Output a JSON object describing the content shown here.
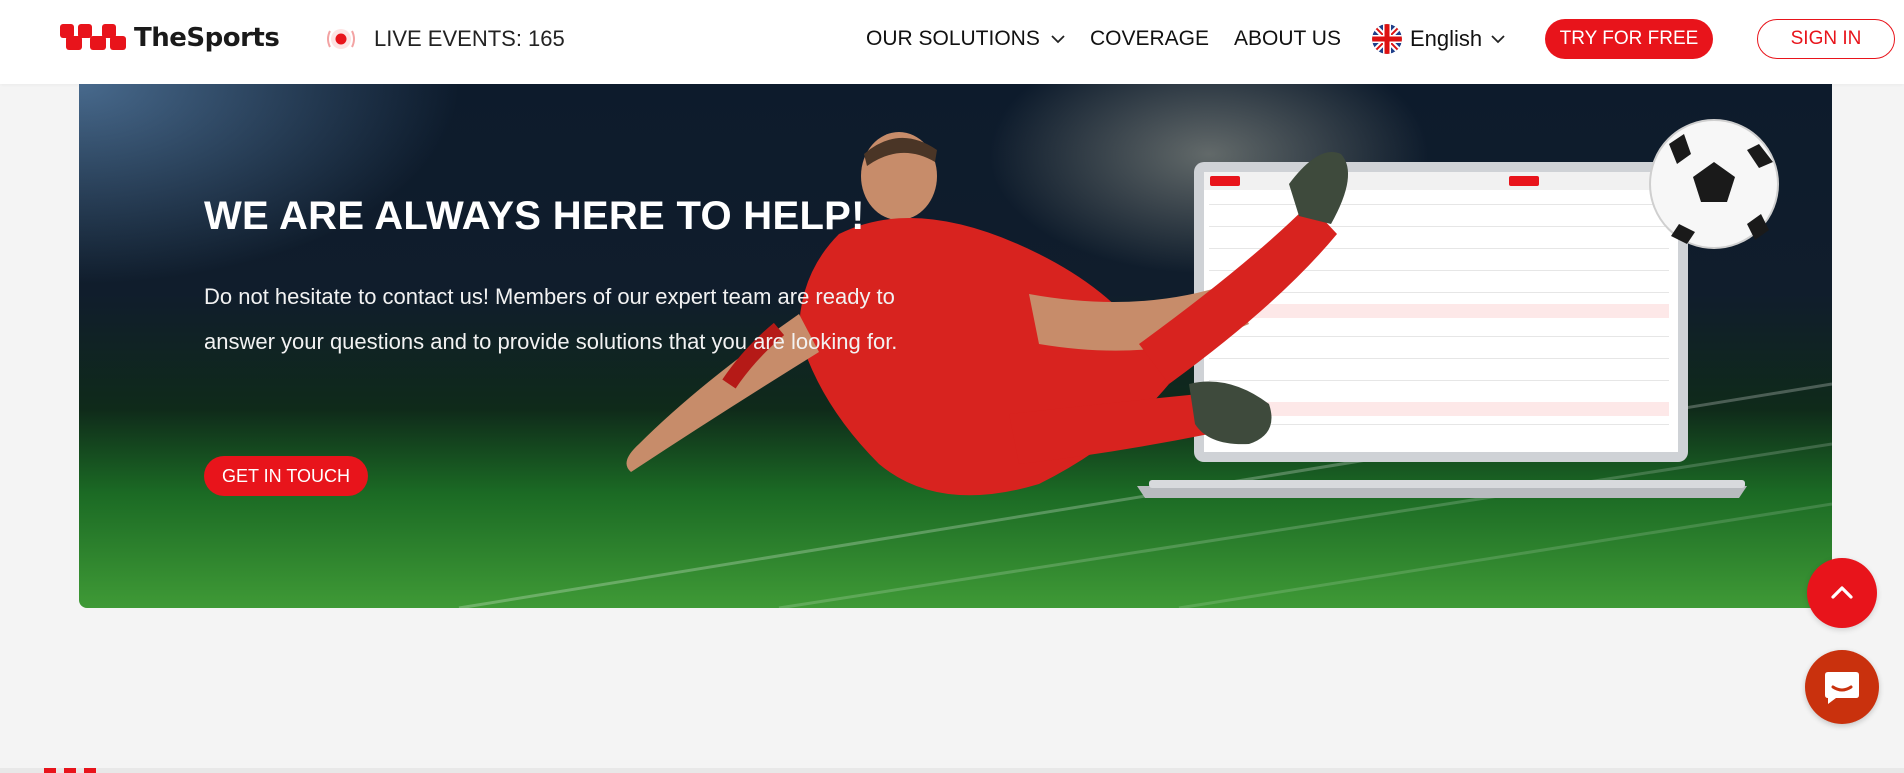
{
  "header": {
    "brand": "TheSports",
    "live_label": "LIVE EVENTS: 165",
    "nav": {
      "solutions": "OUR SOLUTIONS",
      "coverage": "COVERAGE",
      "about": "ABOUT US"
    },
    "language": "English",
    "try_label": "TRY FOR FREE",
    "signin_label": "SIGN IN"
  },
  "banner": {
    "title": "WE ARE ALWAYS HERE TO HELP!",
    "body": "Do not hesitate to contact us! Members of our expert team are ready to answer your questions and to provide solutions that you are looking for.",
    "cta_label": "GET IN TOUCH"
  },
  "icons": {
    "scroll_top": "chevron-up-icon",
    "chat": "chat-bubble-icon",
    "language_flag": "uk-flag-icon",
    "live_indicator": "live-dot-icon"
  },
  "colors": {
    "brand_red": "#e8141b",
    "chat_orange": "#c9310d",
    "page_bg": "#f4f4f4"
  }
}
